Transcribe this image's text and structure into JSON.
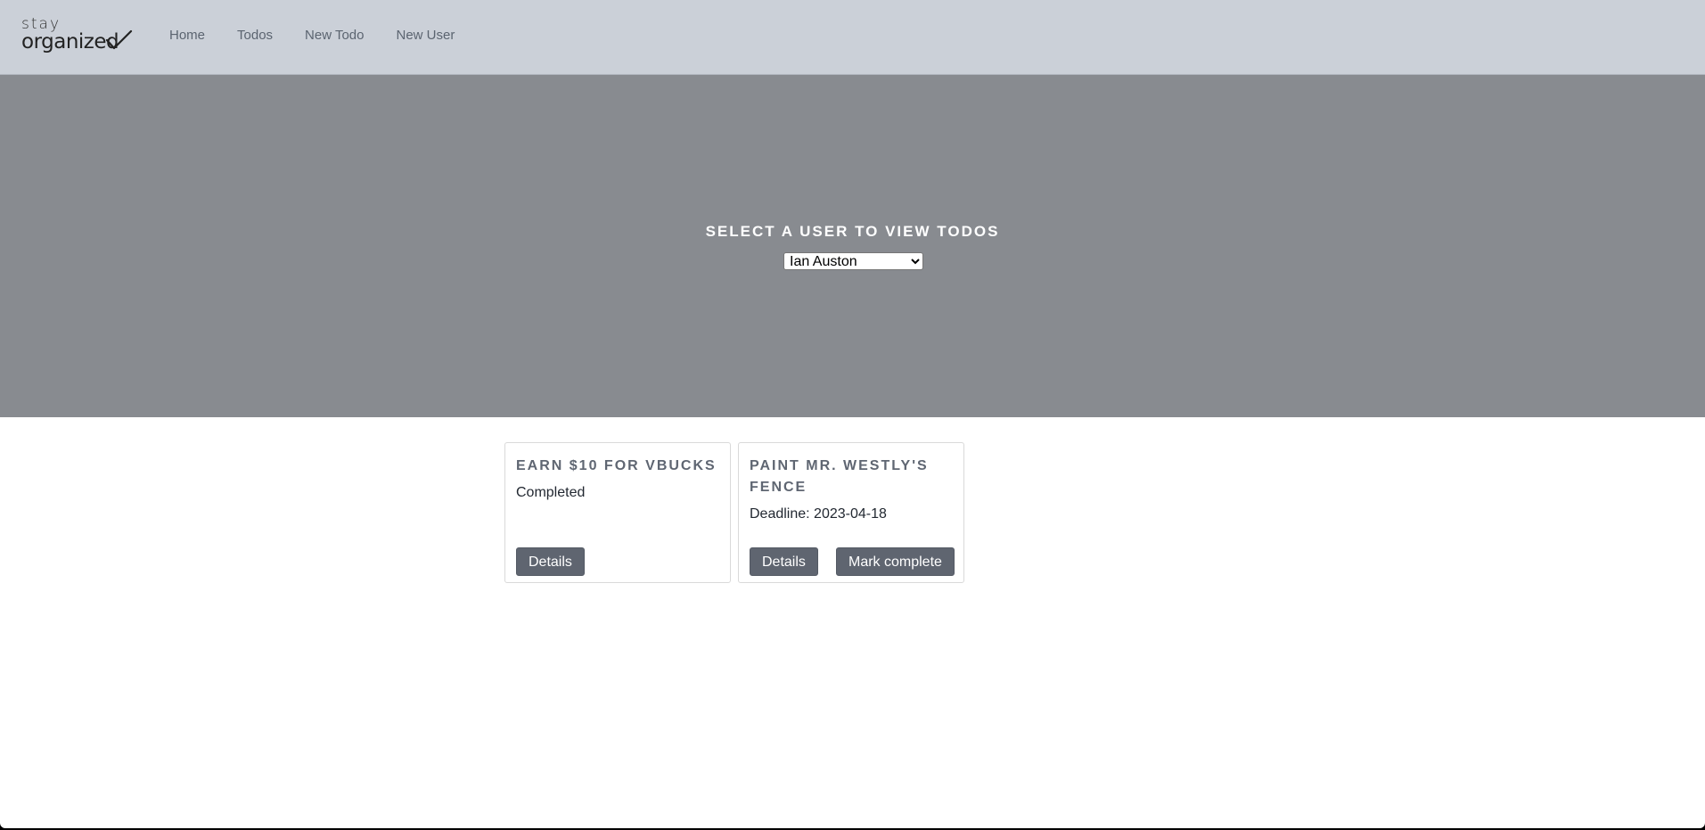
{
  "brand": {
    "top": "stay",
    "bottom": "organized"
  },
  "nav": {
    "items": [
      "Home",
      "Todos",
      "New Todo",
      "New User"
    ]
  },
  "hero": {
    "title": "SELECT A USER TO VIEW TODOS",
    "selected_user": "Ian Auston"
  },
  "todos": [
    {
      "title": "Earn $10 for vbucks",
      "status": "Completed",
      "details_label": "Details"
    },
    {
      "title": "Paint Mr. Westly's fence",
      "status": "Deadline: 2023-04-18",
      "details_label": "Details",
      "complete_label": "Mark complete"
    }
  ],
  "colors": {
    "navbar": "#cbd0d8",
    "hero": "#888b90",
    "button": "#5f6570",
    "card_title": "#5f6672"
  }
}
